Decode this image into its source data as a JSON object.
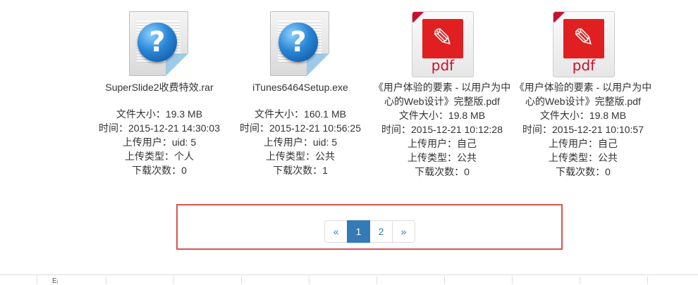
{
  "files": [
    {
      "icon": "unknown-file-icon",
      "name": "SuperSlide2收费特效.rar",
      "size": "文件大小：19.3 MB",
      "time": "时间：2015-12-21 14:30:03",
      "user": "上传用户：uid: 5",
      "type": "上传类型：个人",
      "downloads": "下载次数：0"
    },
    {
      "icon": "unknown-file-icon",
      "name": "iTunes6464Setup.exe",
      "size": "文件大小：160.1 MB",
      "time": "时间：2015-12-21 10:56:25",
      "user": "上传用户：uid: 5",
      "type": "上传类型：公共",
      "downloads": "下载次数：1"
    },
    {
      "icon": "pdf-file-icon",
      "icon_label": "pdf",
      "name": "《用户体验的要素 - 以用户为中心的Web设计》完整版.pdf",
      "size": "文件大小：19.8 MB",
      "time": "时间：2015-12-21 10:12:28",
      "user": "上传用户：自己",
      "type": "上传类型：公共",
      "downloads": "下载次数：0"
    },
    {
      "icon": "pdf-file-icon",
      "icon_label": "pdf",
      "name": "《用户体验的要素 - 以用户为中心的Web设计》完整版.pdf",
      "size": "文件大小：19.8 MB",
      "time": "时间：2015-12-21 10:10:57",
      "user": "上传用户：自己",
      "type": "上传类型：公共",
      "downloads": "下载次数：0"
    }
  ],
  "pagination": {
    "prev": "«",
    "pages": [
      "1",
      "2"
    ],
    "active": "1",
    "next": "»"
  },
  "bottom_strip": {
    "text": "Eᵢ"
  },
  "colors": {
    "accent": "#337ab7",
    "highlight_border": "#d9534f",
    "pdf_red": "#e02020"
  }
}
